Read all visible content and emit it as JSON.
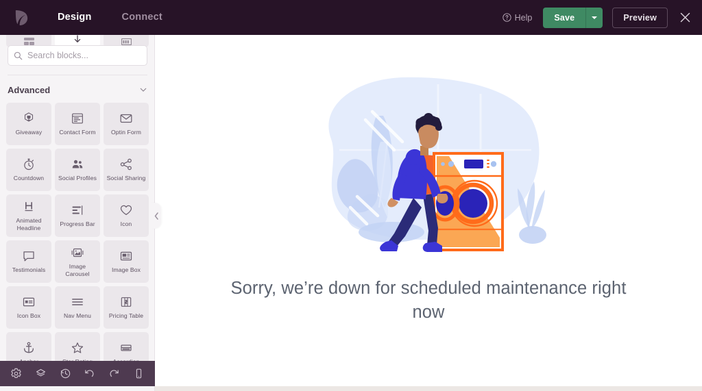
{
  "header": {
    "logo_icon": "leaf-logo-icon",
    "nav": [
      {
        "label": "Design",
        "active": true
      },
      {
        "label": "Connect",
        "active": false
      }
    ],
    "help_label": "Help",
    "help_icon": "question-circle-icon",
    "save_label": "Save",
    "save_dropdown_icon": "caret-down-icon",
    "preview_label": "Preview",
    "close_icon": "close-icon",
    "bg_color": "#271327",
    "save_color": "#3f8a63"
  },
  "sidebar": {
    "tabs": [
      {
        "icon": "blocks-icon",
        "selected": false
      },
      {
        "icon": "download-templates-icon",
        "selected": true
      },
      {
        "icon": "settings-grid-icon",
        "selected": false
      }
    ],
    "search": {
      "placeholder": "Search blocks...",
      "value": "",
      "icon": "search-icon"
    },
    "section": {
      "title": "Advanced",
      "collapse_icon": "chevron-down-icon",
      "expanded": true
    },
    "blocks": [
      {
        "label": "Giveaway",
        "icon": "trophy-icon"
      },
      {
        "label": "Contact Form",
        "icon": "form-window-icon"
      },
      {
        "label": "Optin Form",
        "icon": "envelope-icon"
      },
      {
        "label": "Countdown",
        "icon": "stopwatch-icon"
      },
      {
        "label": "Social Profiles",
        "icon": "people-icon"
      },
      {
        "label": "Social Sharing",
        "icon": "share-icon"
      },
      {
        "label": "Animated Headline",
        "icon": "letter-h-icon"
      },
      {
        "label": "Progress Bar",
        "icon": "progress-bars-icon"
      },
      {
        "label": "Icon",
        "icon": "heart-icon"
      },
      {
        "label": "Testimonials",
        "icon": "speech-bubble-icon"
      },
      {
        "label": "Image Carousel",
        "icon": "image-carousel-icon"
      },
      {
        "label": "Image Box",
        "icon": "image-box-icon"
      },
      {
        "label": "Icon Box",
        "icon": "icon-box-icon"
      },
      {
        "label": "Nav Menu",
        "icon": "hamburger-menu-icon"
      },
      {
        "label": "Pricing Table",
        "icon": "pricing-table-icon"
      },
      {
        "label": "Anchor",
        "icon": "anchor-icon"
      },
      {
        "label": "Star Rating",
        "icon": "star-icon"
      },
      {
        "label": "Accordion",
        "icon": "accordion-icon"
      }
    ],
    "collapse_handle_icon": "chevron-left-icon",
    "bg_color": "#f6f4f6"
  },
  "bottom_toolbar": {
    "bg_color": "#4e3a50",
    "buttons": [
      {
        "name": "settings",
        "icon": "gear-icon"
      },
      {
        "name": "layers",
        "icon": "layers-icon"
      },
      {
        "name": "revisions",
        "icon": "clock-history-icon"
      },
      {
        "name": "undo",
        "icon": "undo-arrow-icon"
      },
      {
        "name": "redo",
        "icon": "redo-arrow-icon"
      },
      {
        "name": "responsive-preview",
        "icon": "mobile-device-icon"
      }
    ]
  },
  "canvas": {
    "headline": "Sorry, we’re down for scheduled maintenance right now",
    "illustration": {
      "name": "maintenance-washing-machine-illustration",
      "alt": "Person walking past an orange washing machine with blue plants",
      "colors": {
        "blob": "#e3ebfb",
        "foliage": "#bfd0f3",
        "machine_orange": "#ff6b1a",
        "machine_fill": "#fba045",
        "clothes_blue": "#3b32d9",
        "clothes_orange": "#f4622a",
        "pants_navy": "#2a2a7a",
        "skin": "#c98b60",
        "hair": "#221c3d"
      }
    },
    "bg_color": "#ffffff"
  }
}
